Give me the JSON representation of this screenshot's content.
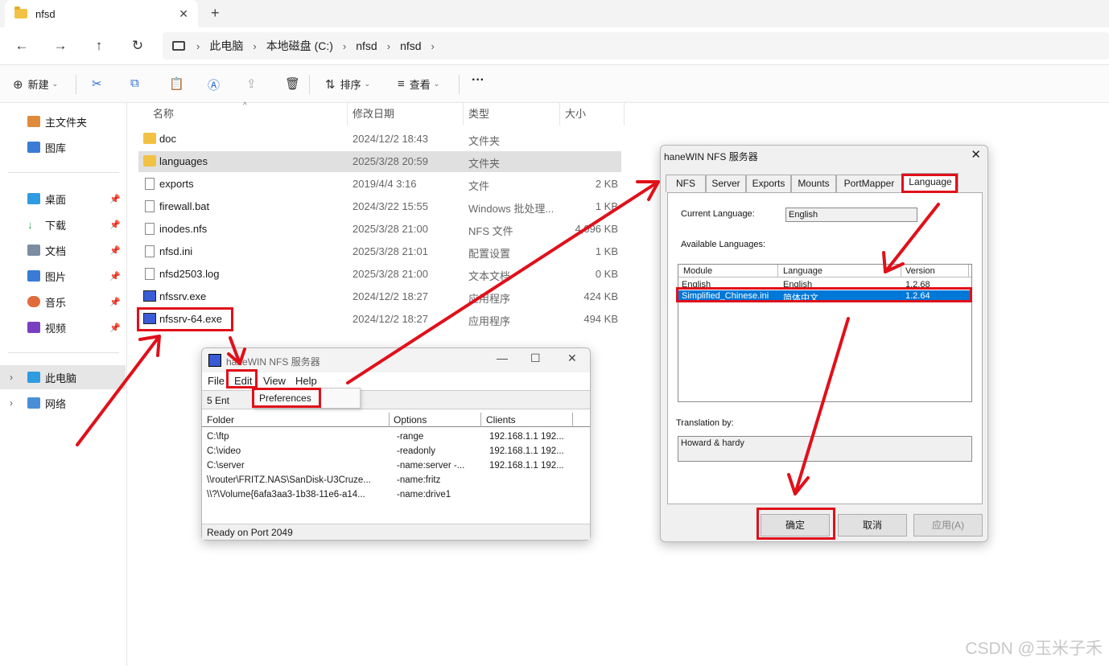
{
  "explorer": {
    "tab_title": "nfsd",
    "tab_close": "✕",
    "new_tab": "+",
    "breadcrumb": [
      "此电脑",
      "本地磁盘 (C:)",
      "nfsd",
      "nfsd"
    ],
    "toolbar": {
      "new_label": "新建",
      "sort_label": "排序",
      "view_label": "查看",
      "more": "···"
    },
    "sidebar": {
      "home": "主文件夹",
      "gallery": "图库",
      "desktop": "桌面",
      "downloads": "下载",
      "documents": "文档",
      "pictures": "图片",
      "music": "音乐",
      "videos": "视频",
      "this_pc": "此电脑",
      "network": "网络"
    },
    "columns": {
      "name": "名称",
      "date": "修改日期",
      "type": "类型",
      "size": "大小"
    },
    "files": [
      {
        "name": "doc",
        "date": "2024/12/2 18:43",
        "type": "文件夹",
        "size": ""
      },
      {
        "name": "languages",
        "date": "2025/3/28 20:59",
        "type": "文件夹",
        "size": ""
      },
      {
        "name": "exports",
        "date": "2019/4/4 3:16",
        "type": "文件",
        "size": "2 KB"
      },
      {
        "name": "firewall.bat",
        "date": "2024/3/22 15:55",
        "type": "Windows 批处理...",
        "size": "1 KB"
      },
      {
        "name": "inodes.nfs",
        "date": "2025/3/28 21:00",
        "type": "NFS 文件",
        "size": "4,096 KB"
      },
      {
        "name": "nfsd.ini",
        "date": "2025/3/28 21:01",
        "type": "配置设置",
        "size": "1 KB"
      },
      {
        "name": "nfsd2503.log",
        "date": "2025/3/28 21:00",
        "type": "文本文档",
        "size": "0 KB"
      },
      {
        "name": "nfssrv.exe",
        "date": "2024/12/2 18:27",
        "type": "应用程序",
        "size": "424 KB"
      },
      {
        "name": "nfssrv-64.exe",
        "date": "2024/12/2 18:27",
        "type": "应用程序",
        "size": "494 KB"
      }
    ]
  },
  "mainwin": {
    "title": "haneWIN NFS 服务器",
    "menu": {
      "file": "File",
      "edit": "Edit",
      "view": "View",
      "help": "Help"
    },
    "entries_text": "5 Ent",
    "dropdown_item": "Preferences",
    "columns": {
      "folder": "Folder",
      "options": "Options",
      "clients": "Clients"
    },
    "rows": [
      {
        "folder": "C:\\ftp",
        "options": "-range",
        "clients": "192.168.1.1  192..."
      },
      {
        "folder": "C:\\video",
        "options": "-readonly",
        "clients": "192.168.1.1  192..."
      },
      {
        "folder": "C:\\server",
        "options": "-name:server -...",
        "clients": "192.168.1.1  192..."
      },
      {
        "folder": "\\\\router\\FRITZ.NAS\\SanDisk-U3Cruze...",
        "options": "-name:fritz",
        "clients": ""
      },
      {
        "folder": "\\\\?\\Volume{6afa3aa3-1b38-11e6-a14...",
        "options": "-name:drive1",
        "clients": ""
      }
    ],
    "status": "Ready on Port 2049"
  },
  "dialog": {
    "title": "haneWIN NFS 服务器",
    "tabs": [
      "NFS",
      "Server",
      "Exports",
      "Mounts",
      "PortMapper",
      "Language"
    ],
    "current_language_label": "Current Language:",
    "current_language_value": "English",
    "available_label": "Available Languages:",
    "list_columns": {
      "module": "Module",
      "language": "Language",
      "version": "Version"
    },
    "languages": [
      {
        "module": "English",
        "language": "English",
        "version": "1.2.68"
      },
      {
        "module": "Simplified_Chinese.ini",
        "language": "简体中文",
        "version": "1.2.64"
      }
    ],
    "translation_label": "Translation by:",
    "translation_value": "Howard & hardy",
    "buttons": {
      "ok": "确定",
      "cancel": "取消",
      "apply": "应用(A)"
    }
  },
  "watermark": "CSDN @玉米子禾",
  "annotation_color": "#e0101a"
}
